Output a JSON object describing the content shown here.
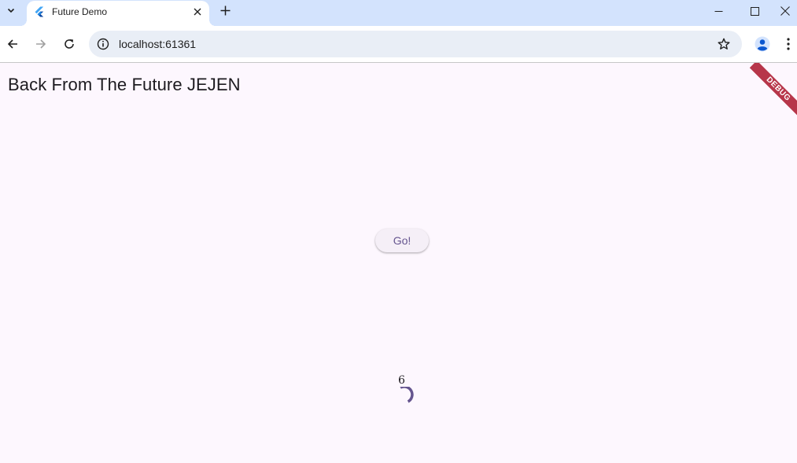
{
  "browser": {
    "tab": {
      "title": "Future Demo",
      "favicon": "flutter-icon"
    },
    "address_bar": {
      "url": "localhost:61361"
    },
    "icons": {
      "tab_search": "chevron-down-icon",
      "close_tab": "close-icon",
      "new_tab": "plus-icon",
      "back": "arrow-left-icon",
      "forward": "arrow-right-icon",
      "reload": "reload-icon",
      "site_info": "info-icon",
      "bookmark": "star-icon",
      "profile": "account-icon",
      "menu": "kebab-menu-icon",
      "minimize": "minimize-icon",
      "maximize": "maximize-icon",
      "close_window": "close-icon"
    }
  },
  "app": {
    "title": "Back From The Future JEJEN",
    "debug_banner": "DEBUG",
    "go_button": "Go!",
    "counter": "6",
    "spinner_state": "loading"
  },
  "colors": {
    "background": "#fdf7fe",
    "accent": "#65558f",
    "tabstrip": "#d3e3fd",
    "debug_banner": "#b7364a"
  }
}
